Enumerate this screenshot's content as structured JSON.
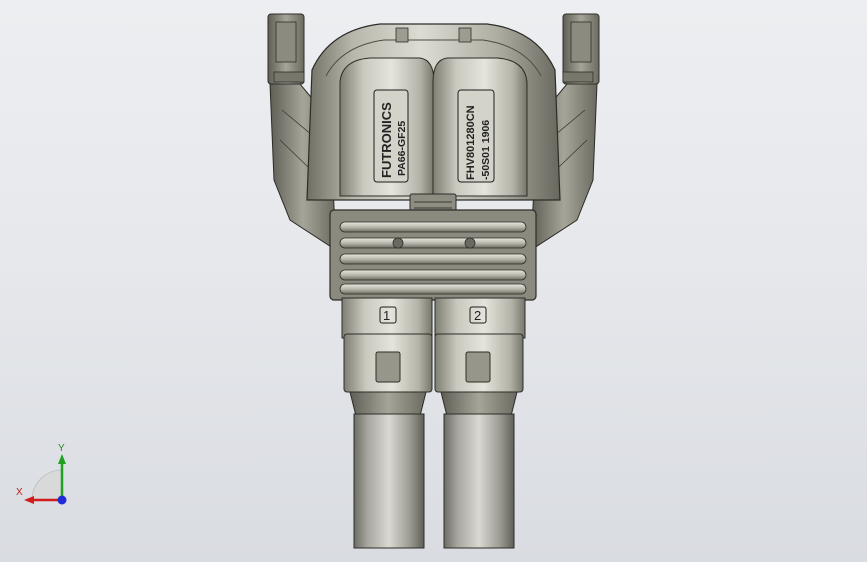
{
  "model": {
    "label_left": {
      "line1": "FUTRONICS",
      "line2": "PA66-GF25"
    },
    "label_right": {
      "line1": "FHV801280CN",
      "line2": "-50S01   1906"
    },
    "pin_labels": [
      "1",
      "2"
    ]
  },
  "triad": {
    "x_label": "X",
    "y_label": "Y",
    "colors": {
      "x": "#d21c1c",
      "y": "#1fa31f",
      "z": "#1f2bd6"
    }
  }
}
